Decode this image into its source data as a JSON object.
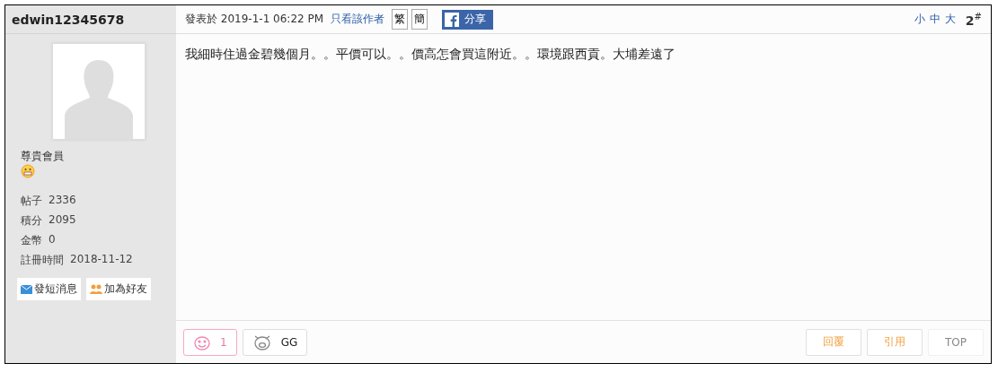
{
  "author": {
    "name": "edwin12345678",
    "rank": "尊貴會員",
    "stats": [
      {
        "label": "帖子",
        "value": "2336"
      },
      {
        "label": "積分",
        "value": "2095"
      },
      {
        "label": "金幣",
        "value": "0"
      },
      {
        "label": "註冊時間",
        "value": "2018-11-12"
      }
    ],
    "actions": [
      {
        "kind": "message",
        "label": "發短消息"
      },
      {
        "kind": "friend",
        "label": "加為好友"
      }
    ]
  },
  "post": {
    "posted": "發表於 2019-1-1 06:22 PM",
    "author_only": "只看該作者",
    "script_buttons": [
      "繁",
      "簡"
    ],
    "share": "分享",
    "font_sizes": [
      "小",
      "中",
      "大"
    ],
    "floor": "2",
    "floor_mark": "#",
    "body": "我細時住過金碧幾個月。。平價可以。。價高怎會買這附近。。環境跟西貢。大埔差遠了"
  },
  "reactions": [
    {
      "kind": "love",
      "label": "1",
      "selected": true
    },
    {
      "kind": "pig",
      "label": "GG",
      "selected": false
    }
  ],
  "footer_buttons": [
    {
      "label": "回覆",
      "disabled": false
    },
    {
      "label": "引用",
      "disabled": false
    },
    {
      "label": "TOP",
      "disabled": true
    }
  ]
}
